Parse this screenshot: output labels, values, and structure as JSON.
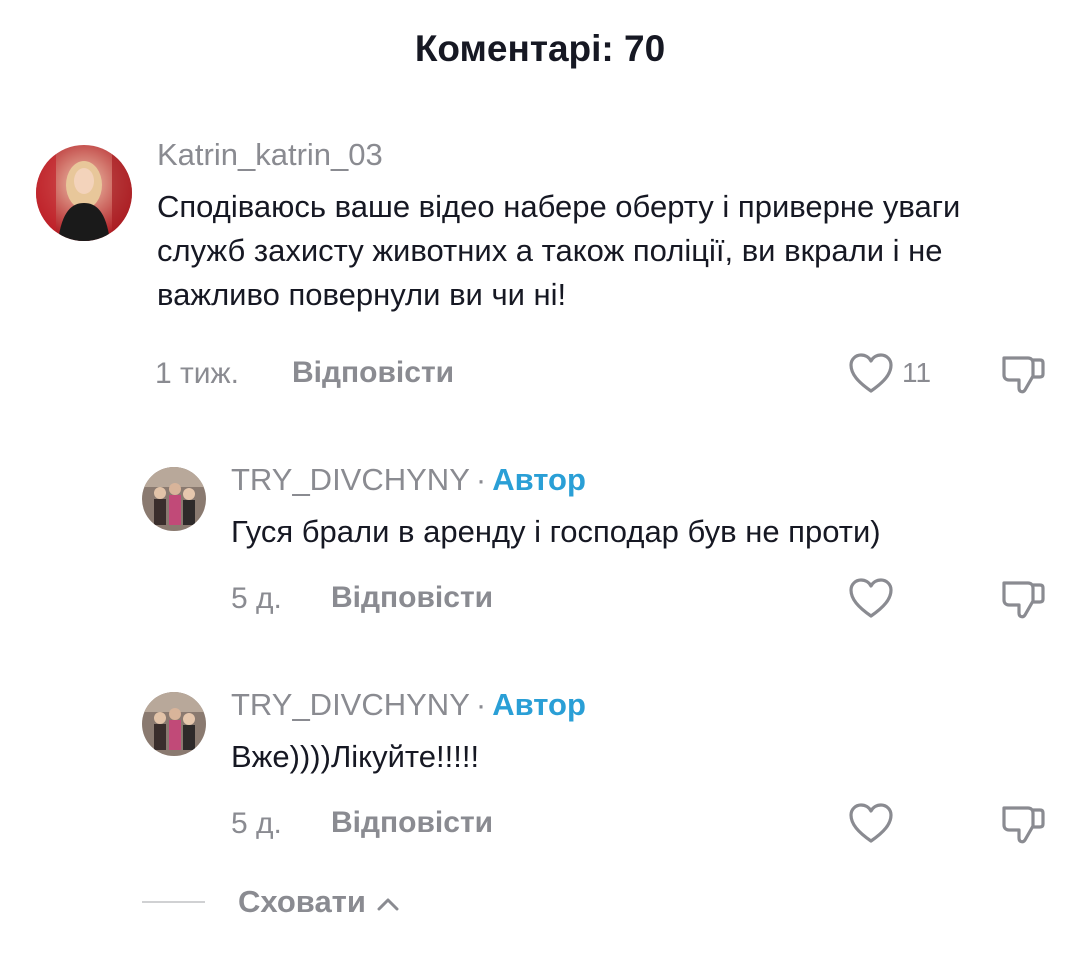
{
  "header": {
    "title": "Коментарі: 70"
  },
  "comments": [
    {
      "username": "Katrin_katrin_03",
      "text": "Сподіваюсь ваше відео набере оберту і приверне уваги служб захисту животних а також поліції, ви вкрали і не важливо повернули ви чи ні!",
      "time": "1 тиж.",
      "reply_label": "Відповісти",
      "like_count": "11"
    }
  ],
  "replies": [
    {
      "username": "TRY_DIVCHYNY",
      "separator": "·",
      "badge": "Автор",
      "text": "Гуся брали в аренду і господар був не проти)",
      "time": "5 д.",
      "reply_label": "Відповісти"
    },
    {
      "username": "TRY_DIVCHYNY",
      "separator": "·",
      "badge": "Автор",
      "text": "Вже))))Лікуйте!!!!!",
      "time": "5 д.",
      "reply_label": "Відповісти"
    }
  ],
  "hide_replies_label": "Сховати",
  "icons": {
    "like": "heart-outline-icon",
    "dislike": "thumbs-down-outline-icon",
    "collapse": "chevron-up-icon"
  },
  "colors": {
    "author_badge": "#2a9fd6",
    "secondary_text": "#8a8b91",
    "primary_text": "#161823"
  }
}
